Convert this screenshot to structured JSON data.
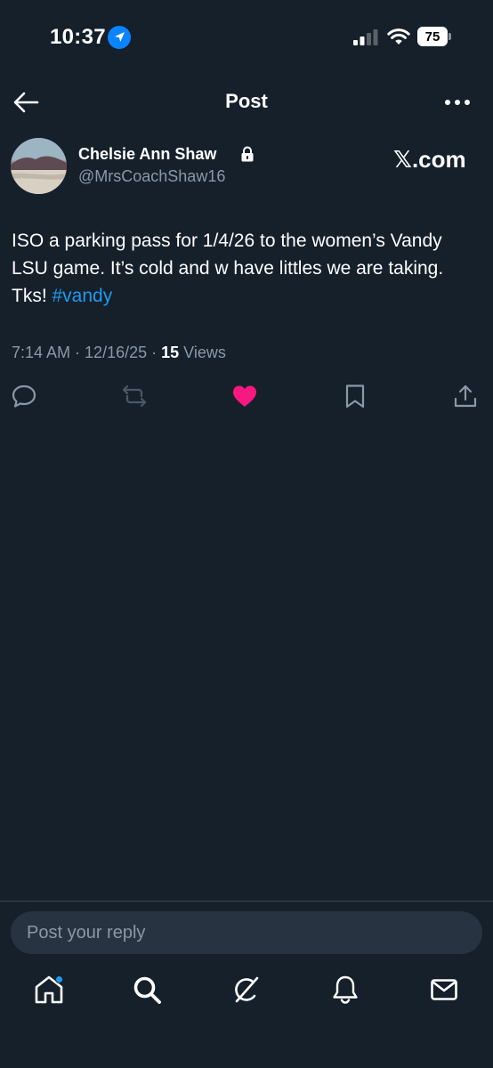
{
  "status_bar": {
    "time": "10:37",
    "battery_level": "75",
    "icons": [
      "location-arrow-icon",
      "cell-signal-icon",
      "wifi-icon",
      "battery-icon"
    ]
  },
  "header": {
    "title": "Post",
    "back_icon": "back-arrow-icon",
    "more_icon": "more-options-icon"
  },
  "post": {
    "author": {
      "display_name": "Chelsie Ann Shaw",
      "handle": "@MrsCoachShaw16",
      "protected": true
    },
    "source_badge": "𝕏.com",
    "text_main": "ISO a parking pass for 1/4/26 to the women’s Vandy LSU game. It’s cold and w have littles we are taking. Tks! ",
    "hashtag": "#vandy",
    "time": "7:14 AM",
    "date": "12/16/25",
    "separator": " · ",
    "views_count": "15",
    "views_label": " Views",
    "liked": true
  },
  "actions": [
    "reply-icon",
    "repost-icon",
    "like-icon",
    "bookmark-icon",
    "share-icon"
  ],
  "reply": {
    "placeholder": "Post your reply"
  },
  "tabbar": {
    "items": [
      "home-icon",
      "search-icon",
      "grok-icon",
      "notifications-icon",
      "messages-icon"
    ],
    "home_has_badge": true
  },
  "colors": {
    "background": "#15202b",
    "accent": "#1d9bf0",
    "like": "#f91880",
    "muted": "#8b98a5"
  }
}
